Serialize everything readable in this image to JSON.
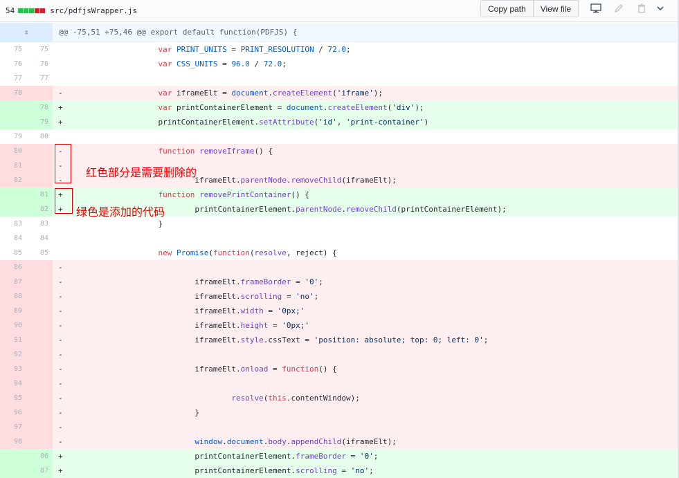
{
  "file": {
    "changes": "54",
    "diffstat_colors": [
      "#2cbe4e",
      "#2cbe4e",
      "#2cbe4e",
      "#cb2431",
      "#cb2431"
    ],
    "path": "src/pdfjsWrapper.js",
    "buttons": {
      "copy_path": "Copy path",
      "view_file": "View file"
    },
    "icons": [
      "desktop-icon",
      "pencil-icon",
      "trash-icon",
      "chevron-down-icon"
    ]
  },
  "hunk": {
    "expand_icon": "expand-icon",
    "expand_glyph": "⇳",
    "header": "@@ -75,51 +75,46 @@ export default function(PDFJS) {"
  },
  "colors": {
    "deletion_bg": "#ffeef0",
    "deletion_gutter": "#ffdce0",
    "addition_bg": "#e6ffed",
    "addition_gutter": "#cdffd8",
    "annotation": "#e00000"
  },
  "lines": [
    {
      "type": "ctx",
      "old": "75",
      "new": "75",
      "sign": "",
      "code": "                    var PRINT_UNITS = PRINT_RESOLUTION / 72.0;"
    },
    {
      "type": "ctx",
      "old": "76",
      "new": "76",
      "sign": "",
      "code": "                    var CSS_UNITS = 96.0 / 72.0;"
    },
    {
      "type": "ctx",
      "old": "77",
      "new": "77",
      "sign": "",
      "code": ""
    },
    {
      "type": "del",
      "old": "78",
      "new": "",
      "sign": "-",
      "code": "                    var iframeElt = document.createElement('iframe');"
    },
    {
      "type": "add",
      "old": "",
      "new": "78",
      "sign": "+",
      "code": "                    var printContainerElement = document.createElement('div');"
    },
    {
      "type": "add",
      "old": "",
      "new": "79",
      "sign": "+",
      "code": "                    printContainerElement.setAttribute('id', 'print-container')"
    },
    {
      "type": "ctx",
      "old": "79",
      "new": "80",
      "sign": "",
      "code": ""
    },
    {
      "type": "del",
      "old": "80",
      "new": "",
      "sign": "-",
      "code": "                    function removeIframe() {"
    },
    {
      "type": "del",
      "old": "81",
      "new": "",
      "sign": "-",
      "code": ""
    },
    {
      "type": "del",
      "old": "82",
      "new": "",
      "sign": "-",
      "code": "                            iframeElt.parentNode.removeChild(iframeElt);"
    },
    {
      "type": "add",
      "old": "",
      "new": "81",
      "sign": "+",
      "code": "                    function removePrintContainer() {"
    },
    {
      "type": "add",
      "old": "",
      "new": "82",
      "sign": "+",
      "code": "                            printContainerElement.parentNode.removeChild(printContainerElement);"
    },
    {
      "type": "ctx",
      "old": "83",
      "new": "83",
      "sign": "",
      "code": "                    }"
    },
    {
      "type": "ctx",
      "old": "84",
      "new": "84",
      "sign": "",
      "code": ""
    },
    {
      "type": "ctx",
      "old": "85",
      "new": "85",
      "sign": "",
      "code": "                    new Promise(function(resolve, reject) {"
    },
    {
      "type": "del",
      "old": "86",
      "new": "",
      "sign": "-",
      "code": ""
    },
    {
      "type": "del",
      "old": "87",
      "new": "",
      "sign": "-",
      "code": "                            iframeElt.frameBorder = '0';"
    },
    {
      "type": "del",
      "old": "88",
      "new": "",
      "sign": "-",
      "code": "                            iframeElt.scrolling = 'no';"
    },
    {
      "type": "del",
      "old": "89",
      "new": "",
      "sign": "-",
      "code": "                            iframeElt.width = '0px;'"
    },
    {
      "type": "del",
      "old": "90",
      "new": "",
      "sign": "-",
      "code": "                            iframeElt.height = '0px;'"
    },
    {
      "type": "del",
      "old": "91",
      "new": "",
      "sign": "-",
      "code": "                            iframeElt.style.cssText = 'position: absolute; top: 0; left: 0';"
    },
    {
      "type": "del",
      "old": "92",
      "new": "",
      "sign": "-",
      "code": ""
    },
    {
      "type": "del",
      "old": "93",
      "new": "",
      "sign": "-",
      "code": "                            iframeElt.onload = function() {"
    },
    {
      "type": "del",
      "old": "94",
      "new": "",
      "sign": "-",
      "code": ""
    },
    {
      "type": "del",
      "old": "95",
      "new": "",
      "sign": "-",
      "code": "                                    resolve(this.contentWindow);"
    },
    {
      "type": "del",
      "old": "96",
      "new": "",
      "sign": "-",
      "code": "                            }"
    },
    {
      "type": "del",
      "old": "97",
      "new": "",
      "sign": "-",
      "code": ""
    },
    {
      "type": "del",
      "old": "98",
      "new": "",
      "sign": "-",
      "code": "                            window.document.body.appendChild(iframeElt);"
    },
    {
      "type": "add",
      "old": "",
      "new": "86",
      "sign": "+",
      "code": "                            printContainerElement.frameBorder = '0';"
    },
    {
      "type": "add",
      "old": "",
      "new": "87",
      "sign": "+",
      "code": "                            printContainerElement.scrolling = 'no';"
    }
  ],
  "annotations": {
    "red_label": "红色部分是需要删除的",
    "green_label": "绿色是添加的代码"
  }
}
